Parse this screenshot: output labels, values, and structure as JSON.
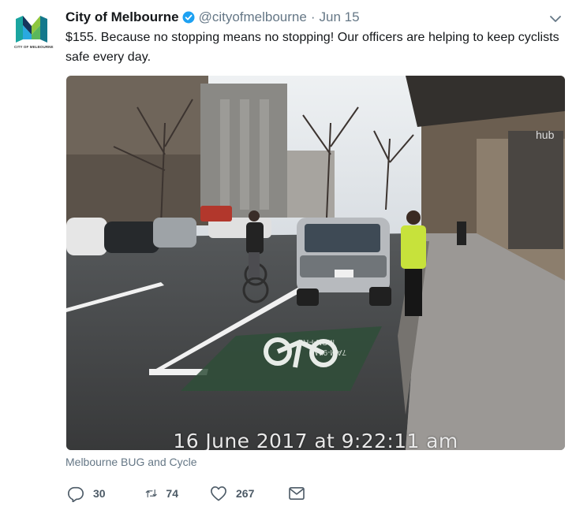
{
  "tweet": {
    "author_name": "City of Melbourne",
    "handle": "@cityofmelbourne",
    "separator": "·",
    "date": "Jun 15",
    "text": "$155. Because no stopping means no stopping! Our officers are helping to keep cyclists safe every day.",
    "avatar_label": "CITY OF MELBOURNE",
    "verified": true
  },
  "media": {
    "timestamp": "16 June 2017 at 9:22:11 am",
    "road_text_1": "MON-FRI",
    "road_text_2": "7AM-9AM",
    "shop_sign": "hub"
  },
  "source_label": "Melbourne BUG and Cycle",
  "actions": {
    "reply_count": "30",
    "retweet_count": "74",
    "like_count": "267"
  },
  "icons": {
    "avatar": "city-of-melbourne-logo",
    "verified": "verified-badge-icon",
    "caret": "chevron-down-icon",
    "reply": "reply-icon",
    "retweet": "retweet-icon",
    "like": "heart-icon",
    "dm": "envelope-icon"
  },
  "colors": {
    "text": "#14171a",
    "secondary": "#657786",
    "verified": "#1da1f2",
    "logo_teal": "#1aa5a0",
    "logo_green": "#8dc63f",
    "logo_navy": "#16355c"
  }
}
